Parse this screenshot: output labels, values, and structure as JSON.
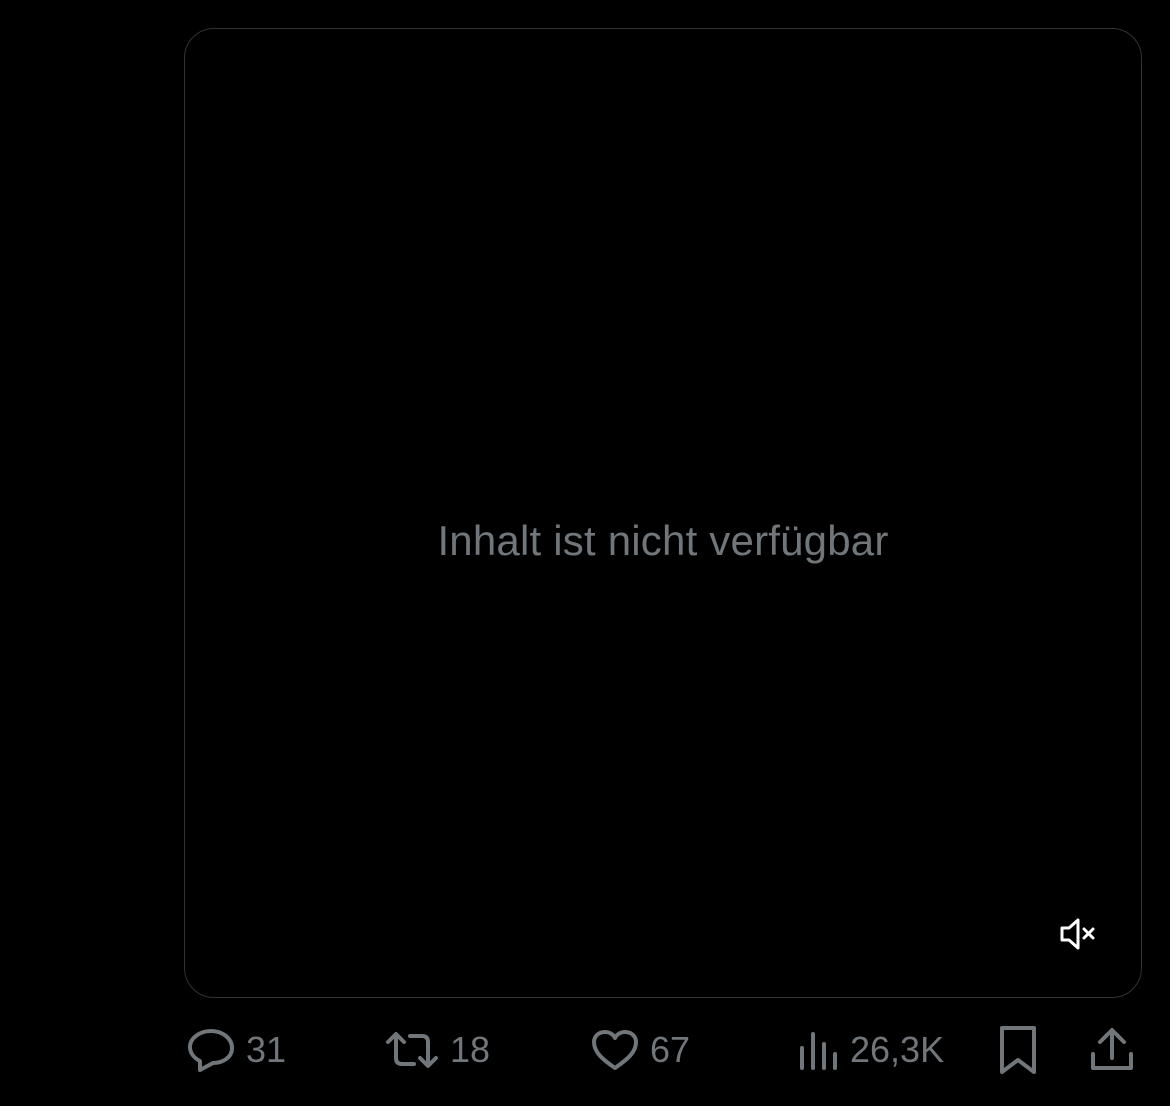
{
  "media": {
    "unavailable_text": "Inhalt ist nicht verfügbar",
    "mute_icon": "speaker-muted-icon"
  },
  "actions": {
    "reply": {
      "icon": "reply-bubble-icon",
      "count": "31"
    },
    "repost": {
      "icon": "repost-arrows-icon",
      "count": "18"
    },
    "like": {
      "icon": "heart-icon",
      "count": "67"
    },
    "views": {
      "icon": "bar-chart-icon",
      "count": "26,3K"
    },
    "bookmark": {
      "icon": "bookmark-icon"
    },
    "share": {
      "icon": "share-upload-icon"
    }
  },
  "colors": {
    "background": "#000000",
    "card_border": "#2f3336",
    "muted_text": "#71767b",
    "icon_white": "#ffffff"
  }
}
